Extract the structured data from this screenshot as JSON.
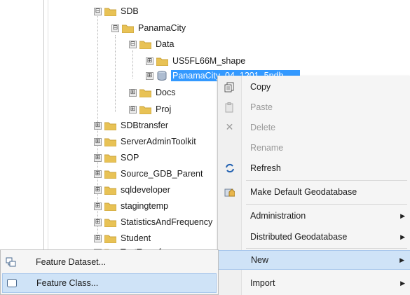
{
  "tree": {
    "items": [
      {
        "label": "SDB",
        "toggle": "⊟"
      },
      {
        "label": "PanamaCity",
        "toggle": "⊟"
      },
      {
        "label": "Data",
        "toggle": "⊟"
      },
      {
        "label": "US5FL66M_shape",
        "toggle": "⊞"
      },
      {
        "label": "PanamaCity_04_1201_5pdb",
        "toggle": "⊞"
      },
      {
        "label": "Docs",
        "toggle": "⊞"
      },
      {
        "label": "Proj",
        "toggle": "⊞"
      },
      {
        "label": "SDBtransfer",
        "toggle": "⊞"
      },
      {
        "label": "ServerAdminToolkit",
        "toggle": "⊞"
      },
      {
        "label": "SOP",
        "toggle": "⊞"
      },
      {
        "label": "Source_GDB_Parent",
        "toggle": "⊞"
      },
      {
        "label": "sqldeveloper",
        "toggle": "⊞"
      },
      {
        "label": "stagingtemp",
        "toggle": "⊞"
      },
      {
        "label": "StatisticsAndFrequency",
        "toggle": "⊞"
      },
      {
        "label": "Student",
        "toggle": "⊞"
      },
      {
        "label": "TestTransfer",
        "toggle": "⊞"
      }
    ]
  },
  "context_menu": {
    "copy": "Copy",
    "paste": "Paste",
    "delete": "Delete",
    "rename": "Rename",
    "refresh": "Refresh",
    "make_default": "Make Default Geodatabase",
    "administration": "Administration",
    "distributed": "Distributed Geodatabase",
    "new": "New",
    "import": "Import"
  },
  "submenu": {
    "feature_dataset": "Feature Dataset...",
    "feature_class": "Feature Class..."
  },
  "colors": {
    "selection": "#3399ff",
    "hover": "#cfe3f7",
    "folder": "#e8c255"
  }
}
